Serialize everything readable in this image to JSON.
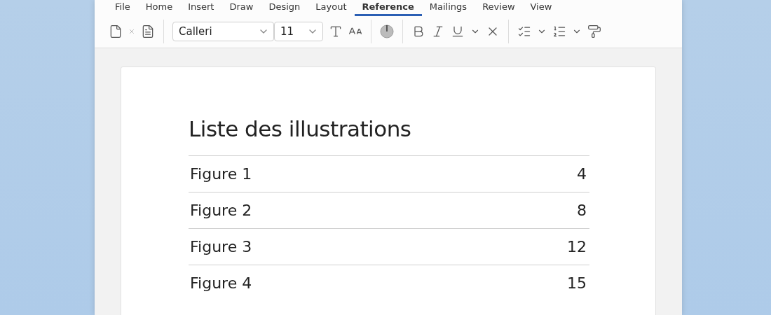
{
  "tabs": [
    {
      "label": "File",
      "selected": false
    },
    {
      "label": "Home",
      "selected": false
    },
    {
      "label": "Insert",
      "selected": false
    },
    {
      "label": "Draw",
      "selected": false
    },
    {
      "label": "Design",
      "selected": false
    },
    {
      "label": "Layout",
      "selected": false
    },
    {
      "label": "Reference",
      "selected": true
    },
    {
      "label": "Mailings",
      "selected": false
    },
    {
      "label": "Review",
      "selected": false
    },
    {
      "label": "View",
      "selected": false
    }
  ],
  "toolbar": {
    "font": "Calleri",
    "size": "11"
  },
  "document": {
    "title": "Liste des illustrations",
    "entries": [
      {
        "label": "Figure 1",
        "page": "4"
      },
      {
        "label": "Figure 2",
        "page": "8"
      },
      {
        "label": "Figure 3",
        "page": "12"
      },
      {
        "label": "Figure 4",
        "page": "15"
      }
    ]
  }
}
